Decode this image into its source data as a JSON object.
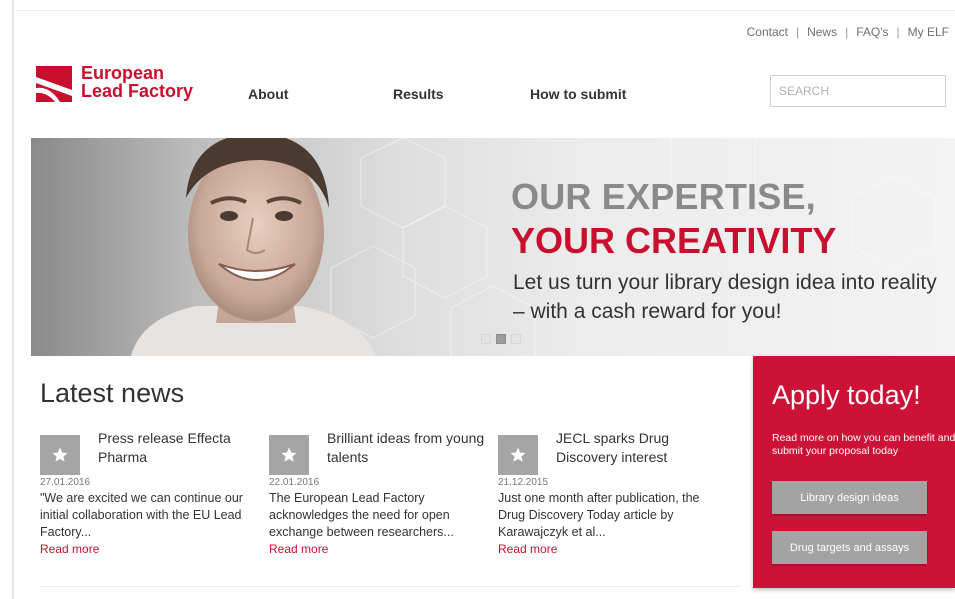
{
  "util_nav": {
    "items": [
      "Contact",
      "News",
      "FAQ's",
      "My ELF"
    ],
    "separator": "|"
  },
  "logo": {
    "line1": "European",
    "line2": "Lead Factory"
  },
  "nav": {
    "about": "About",
    "results": "Results",
    "how_to_submit": "How to submit"
  },
  "search": {
    "placeholder": "SEARCH"
  },
  "hero": {
    "title_line1": "OUR EXPERTISE,",
    "title_line2": "YOUR CREATIVITY",
    "subtitle": "Let us turn your library design idea into reality – with a cash reward for you!",
    "slide_count": 3,
    "active_slide": 2
  },
  "news": {
    "title": "Latest news",
    "items": [
      {
        "headline": "Press release Effecta Pharma",
        "date": "27.01.2016",
        "body": "\"We are excited we can continue our initial collaboration with the EU Lead Factory...",
        "more": "Read more",
        "icon": "star-icon"
      },
      {
        "headline": "Brilliant ideas from young talents",
        "date": "22.01.2016",
        "body": "The European Lead Factory acknowledges the need for open exchange between researchers...",
        "more": "Read more",
        "icon": "star-icon"
      },
      {
        "headline": "JECL sparks Drug Discovery interest",
        "date": "21.12.2015",
        "body": "Just one month after publication, the Drug Discovery Today article by Karawajczyk et al...",
        "more": "Read more",
        "icon": "star-icon"
      }
    ]
  },
  "apply": {
    "title": "Apply today!",
    "text": "Read more on how you can benefit and submit your proposal today",
    "buttons": [
      "Library design ideas",
      "Drug targets and assays"
    ]
  },
  "colors": {
    "brand_red": "#c8102e",
    "panel_red": "#cc1236",
    "button_grey": "#a3a3a3"
  }
}
